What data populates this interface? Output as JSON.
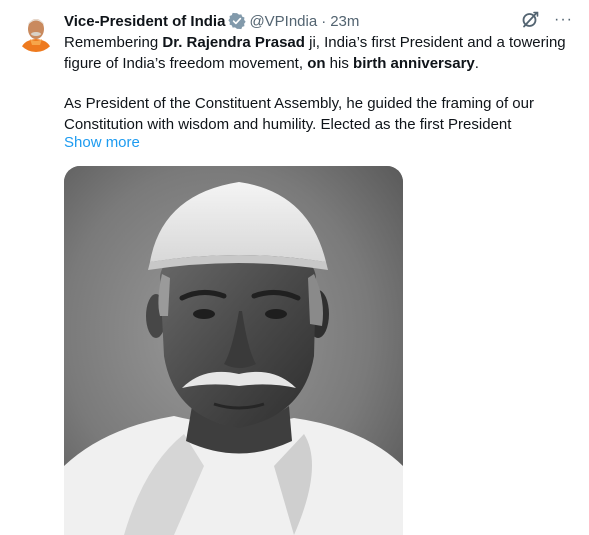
{
  "tweet": {
    "author_name": "Vice-President of India",
    "handle": "@VPIndia",
    "separator": "·",
    "time": "23m",
    "more_glyph": "···",
    "text": {
      "p1_a": "Remembering ",
      "p1_b": "Dr. Rajendra Prasad",
      "p1_c": " ji, India’s first President and a towering figure of India’s freedom movement, ",
      "p1_d": "on",
      "p1_e": " his ",
      "p1_f": "birth anniversary",
      "p1_g": ".",
      "p2": "As President of the Constituent Assembly, he guided the framing of our Constitution with wisdom and humility. Elected as the first President"
    },
    "show_more": "Show more"
  },
  "icons": {
    "verified": "verified-badge-icon",
    "grok": "grok-icon",
    "more": "more-options-icon"
  },
  "colors": {
    "link": "#1d9bf0",
    "secondary_text": "#536471",
    "verified_badge": "#829aab"
  }
}
